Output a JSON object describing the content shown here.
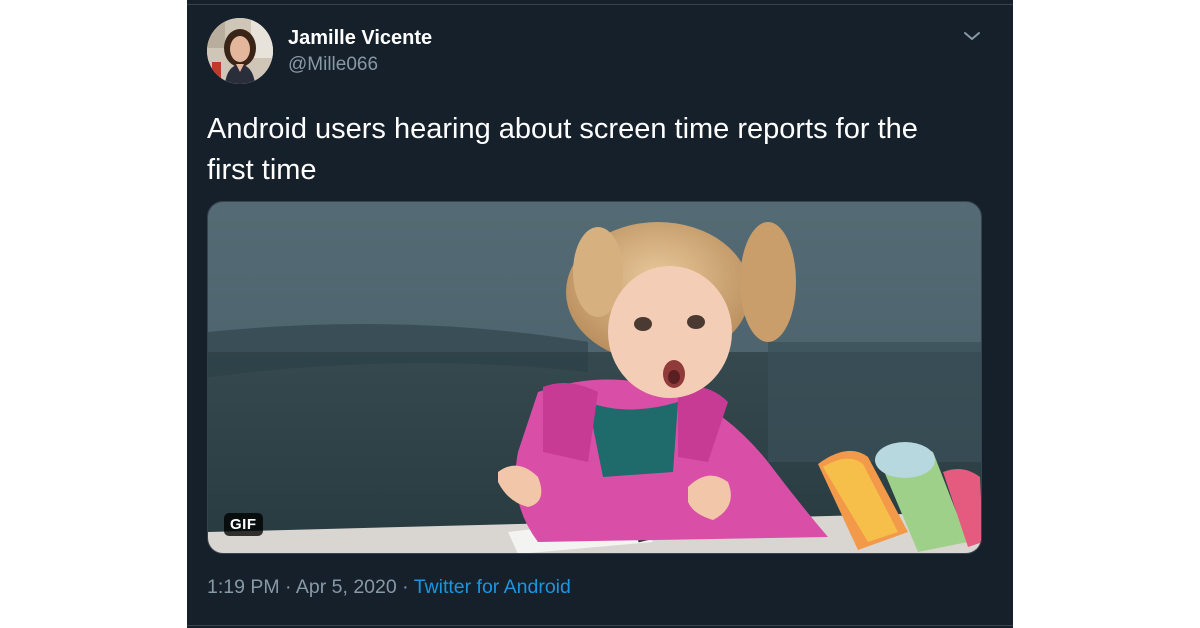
{
  "author": {
    "name": "Jamille Vicente",
    "handle": "@Mille066"
  },
  "tweet": {
    "text_line1": "Android users hearing about screen time reports for the",
    "text_line2": "first time"
  },
  "media": {
    "badge": "GIF"
  },
  "meta": {
    "time": "1:19 PM",
    "sep1": " · ",
    "date": "Apr 5, 2020",
    "sep2": " · ",
    "source": "Twitter for Android"
  },
  "icons": {
    "caret": "chevron-down-icon",
    "avatar": "avatar"
  },
  "colors": {
    "background": "#15202b",
    "name": "#ffffff",
    "secondary": "#8899a6",
    "link": "#1b95e0",
    "border": "#38444d"
  }
}
